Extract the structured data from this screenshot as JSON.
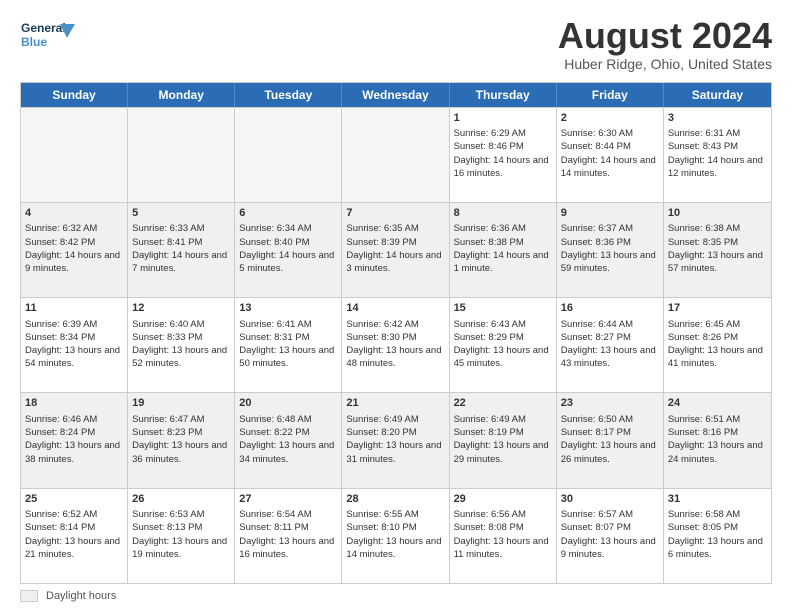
{
  "logo": {
    "line1": "General",
    "line2": "Blue"
  },
  "title": "August 2024",
  "subtitle": "Huber Ridge, Ohio, United States",
  "days_of_week": [
    "Sunday",
    "Monday",
    "Tuesday",
    "Wednesday",
    "Thursday",
    "Friday",
    "Saturday"
  ],
  "footer": {
    "label": "Daylight hours"
  },
  "weeks": [
    [
      {
        "day": "",
        "empty": true
      },
      {
        "day": "",
        "empty": true
      },
      {
        "day": "",
        "empty": true
      },
      {
        "day": "",
        "empty": true
      },
      {
        "day": "1",
        "sunrise": "Sunrise: 6:29 AM",
        "sunset": "Sunset: 8:46 PM",
        "daylight": "Daylight: 14 hours and 16 minutes.",
        "shaded": false
      },
      {
        "day": "2",
        "sunrise": "Sunrise: 6:30 AM",
        "sunset": "Sunset: 8:44 PM",
        "daylight": "Daylight: 14 hours and 14 minutes.",
        "shaded": false
      },
      {
        "day": "3",
        "sunrise": "Sunrise: 6:31 AM",
        "sunset": "Sunset: 8:43 PM",
        "daylight": "Daylight: 14 hours and 12 minutes.",
        "shaded": false
      }
    ],
    [
      {
        "day": "4",
        "sunrise": "Sunrise: 6:32 AM",
        "sunset": "Sunset: 8:42 PM",
        "daylight": "Daylight: 14 hours and 9 minutes.",
        "shaded": true
      },
      {
        "day": "5",
        "sunrise": "Sunrise: 6:33 AM",
        "sunset": "Sunset: 8:41 PM",
        "daylight": "Daylight: 14 hours and 7 minutes.",
        "shaded": true
      },
      {
        "day": "6",
        "sunrise": "Sunrise: 6:34 AM",
        "sunset": "Sunset: 8:40 PM",
        "daylight": "Daylight: 14 hours and 5 minutes.",
        "shaded": true
      },
      {
        "day": "7",
        "sunrise": "Sunrise: 6:35 AM",
        "sunset": "Sunset: 8:39 PM",
        "daylight": "Daylight: 14 hours and 3 minutes.",
        "shaded": true
      },
      {
        "day": "8",
        "sunrise": "Sunrise: 6:36 AM",
        "sunset": "Sunset: 8:38 PM",
        "daylight": "Daylight: 14 hours and 1 minute.",
        "shaded": true
      },
      {
        "day": "9",
        "sunrise": "Sunrise: 6:37 AM",
        "sunset": "Sunset: 8:36 PM",
        "daylight": "Daylight: 13 hours and 59 minutes.",
        "shaded": true
      },
      {
        "day": "10",
        "sunrise": "Sunrise: 6:38 AM",
        "sunset": "Sunset: 8:35 PM",
        "daylight": "Daylight: 13 hours and 57 minutes.",
        "shaded": true
      }
    ],
    [
      {
        "day": "11",
        "sunrise": "Sunrise: 6:39 AM",
        "sunset": "Sunset: 8:34 PM",
        "daylight": "Daylight: 13 hours and 54 minutes.",
        "shaded": false
      },
      {
        "day": "12",
        "sunrise": "Sunrise: 6:40 AM",
        "sunset": "Sunset: 8:33 PM",
        "daylight": "Daylight: 13 hours and 52 minutes.",
        "shaded": false
      },
      {
        "day": "13",
        "sunrise": "Sunrise: 6:41 AM",
        "sunset": "Sunset: 8:31 PM",
        "daylight": "Daylight: 13 hours and 50 minutes.",
        "shaded": false
      },
      {
        "day": "14",
        "sunrise": "Sunrise: 6:42 AM",
        "sunset": "Sunset: 8:30 PM",
        "daylight": "Daylight: 13 hours and 48 minutes.",
        "shaded": false
      },
      {
        "day": "15",
        "sunrise": "Sunrise: 6:43 AM",
        "sunset": "Sunset: 8:29 PM",
        "daylight": "Daylight: 13 hours and 45 minutes.",
        "shaded": false
      },
      {
        "day": "16",
        "sunrise": "Sunrise: 6:44 AM",
        "sunset": "Sunset: 8:27 PM",
        "daylight": "Daylight: 13 hours and 43 minutes.",
        "shaded": false
      },
      {
        "day": "17",
        "sunrise": "Sunrise: 6:45 AM",
        "sunset": "Sunset: 8:26 PM",
        "daylight": "Daylight: 13 hours and 41 minutes.",
        "shaded": false
      }
    ],
    [
      {
        "day": "18",
        "sunrise": "Sunrise: 6:46 AM",
        "sunset": "Sunset: 8:24 PM",
        "daylight": "Daylight: 13 hours and 38 minutes.",
        "shaded": true
      },
      {
        "day": "19",
        "sunrise": "Sunrise: 6:47 AM",
        "sunset": "Sunset: 8:23 PM",
        "daylight": "Daylight: 13 hours and 36 minutes.",
        "shaded": true
      },
      {
        "day": "20",
        "sunrise": "Sunrise: 6:48 AM",
        "sunset": "Sunset: 8:22 PM",
        "daylight": "Daylight: 13 hours and 34 minutes.",
        "shaded": true
      },
      {
        "day": "21",
        "sunrise": "Sunrise: 6:49 AM",
        "sunset": "Sunset: 8:20 PM",
        "daylight": "Daylight: 13 hours and 31 minutes.",
        "shaded": true
      },
      {
        "day": "22",
        "sunrise": "Sunrise: 6:49 AM",
        "sunset": "Sunset: 8:19 PM",
        "daylight": "Daylight: 13 hours and 29 minutes.",
        "shaded": true
      },
      {
        "day": "23",
        "sunrise": "Sunrise: 6:50 AM",
        "sunset": "Sunset: 8:17 PM",
        "daylight": "Daylight: 13 hours and 26 minutes.",
        "shaded": true
      },
      {
        "day": "24",
        "sunrise": "Sunrise: 6:51 AM",
        "sunset": "Sunset: 8:16 PM",
        "daylight": "Daylight: 13 hours and 24 minutes.",
        "shaded": true
      }
    ],
    [
      {
        "day": "25",
        "sunrise": "Sunrise: 6:52 AM",
        "sunset": "Sunset: 8:14 PM",
        "daylight": "Daylight: 13 hours and 21 minutes.",
        "shaded": false
      },
      {
        "day": "26",
        "sunrise": "Sunrise: 6:53 AM",
        "sunset": "Sunset: 8:13 PM",
        "daylight": "Daylight: 13 hours and 19 minutes.",
        "shaded": false
      },
      {
        "day": "27",
        "sunrise": "Sunrise: 6:54 AM",
        "sunset": "Sunset: 8:11 PM",
        "daylight": "Daylight: 13 hours and 16 minutes.",
        "shaded": false
      },
      {
        "day": "28",
        "sunrise": "Sunrise: 6:55 AM",
        "sunset": "Sunset: 8:10 PM",
        "daylight": "Daylight: 13 hours and 14 minutes.",
        "shaded": false
      },
      {
        "day": "29",
        "sunrise": "Sunrise: 6:56 AM",
        "sunset": "Sunset: 8:08 PM",
        "daylight": "Daylight: 13 hours and 11 minutes.",
        "shaded": false
      },
      {
        "day": "30",
        "sunrise": "Sunrise: 6:57 AM",
        "sunset": "Sunset: 8:07 PM",
        "daylight": "Daylight: 13 hours and 9 minutes.",
        "shaded": false
      },
      {
        "day": "31",
        "sunrise": "Sunrise: 6:58 AM",
        "sunset": "Sunset: 8:05 PM",
        "daylight": "Daylight: 13 hours and 6 minutes.",
        "shaded": false
      }
    ]
  ]
}
